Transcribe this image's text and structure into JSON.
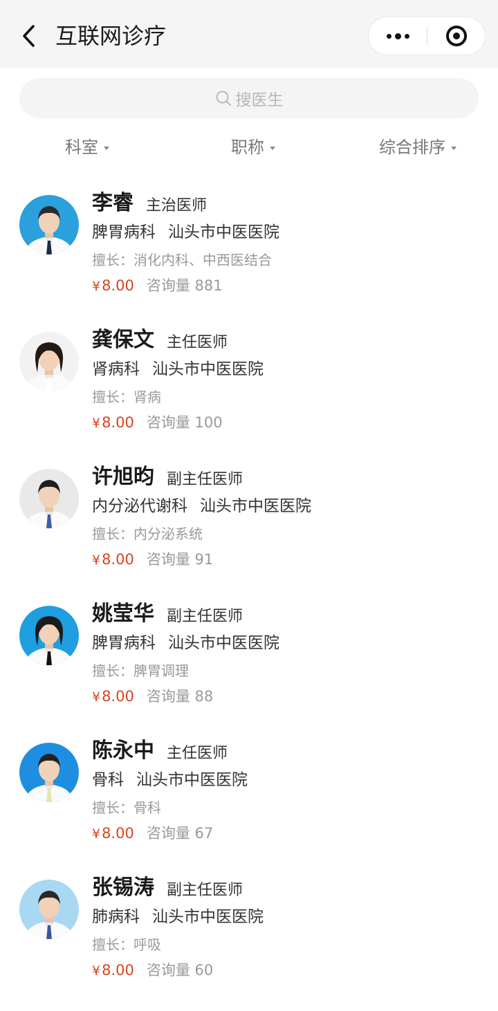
{
  "nav": {
    "title": "互联网诊疗",
    "back_icon": "chevron-left-icon",
    "more_icon": "more-dots-icon",
    "close_icon": "target-circle-icon"
  },
  "search": {
    "placeholder": "搜医生",
    "icon": "search-icon"
  },
  "filters": [
    {
      "label": "科室"
    },
    {
      "label": "职称"
    },
    {
      "label": "综合排序"
    }
  ],
  "currency": "¥",
  "doctors": [
    {
      "name": "李睿",
      "title": "主治医师",
      "department": "脾胃病科",
      "hospital": "汕头市中医医院",
      "skill": "擅长：消化内科、中西医结合",
      "price": "8.00",
      "consult": "咨询量 881",
      "bg": "#2aa0dc",
      "hair": "#2b2b2b",
      "tie": "#1d2b4a",
      "female": false
    },
    {
      "name": "龚保文",
      "title": "主任医师",
      "department": "肾病科",
      "hospital": "汕头市中医医院",
      "skill": "擅长：肾病",
      "price": "8.00",
      "consult": "咨询量 100",
      "bg": "#f2f2f2",
      "hair": "#231a16",
      "tie": "#ffffff",
      "female": true
    },
    {
      "name": "许旭昀",
      "title": "副主任医师",
      "department": "内分泌代谢科",
      "hospital": "汕头市中医医院",
      "skill": "擅长：内分泌系统",
      "price": "8.00",
      "consult": "咨询量 91",
      "bg": "#e9e9e9",
      "hair": "#1e1e1e",
      "tie": "#3d5ea8",
      "female": false
    },
    {
      "name": "姚莹华",
      "title": "副主任医师",
      "department": "脾胃病科",
      "hospital": "汕头市中医医院",
      "skill": "擅长：脾胃调理",
      "price": "8.00",
      "consult": "咨询量 88",
      "bg": "#1f9fe0",
      "hair": "#1b1b1b",
      "tie": "#111111",
      "female": true
    },
    {
      "name": "陈永中",
      "title": "主任医师",
      "department": "骨科",
      "hospital": "汕头市中医医院",
      "skill": "擅长：骨科",
      "price": "8.00",
      "consult": "咨询量 67",
      "bg": "#1e8fe0",
      "hair": "#222222",
      "tie": "#e9e3b0",
      "female": false
    },
    {
      "name": "张锡涛",
      "title": "副主任医师",
      "department": "肺病科",
      "hospital": "汕头市中医医院",
      "skill": "擅长：呼吸",
      "price": "8.00",
      "consult": "咨询量 60",
      "bg": "#a9d8f2",
      "hair": "#2a2a2a",
      "tie": "#3c55a0",
      "female": false
    }
  ]
}
